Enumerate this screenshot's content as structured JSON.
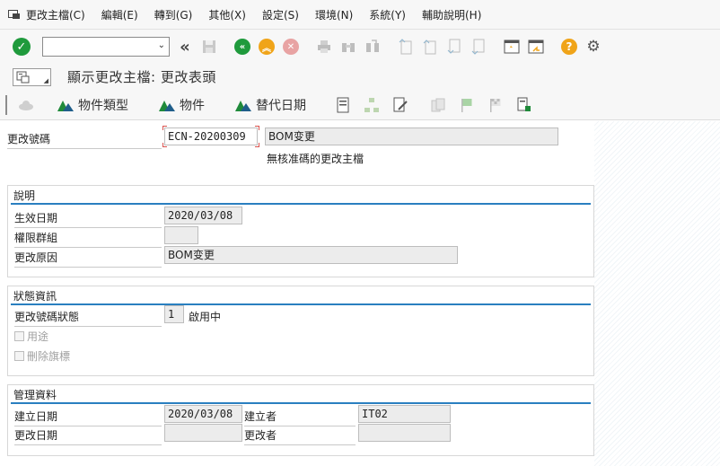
{
  "menu": {
    "items": [
      "更改主檔(C)",
      "編輯(E)",
      "轉到(G)",
      "其他(X)",
      "設定(S)",
      "環境(N)",
      "系統(Y)",
      "輔助說明(H)"
    ]
  },
  "toolbar": {
    "command_field_value": "",
    "icons": [
      "enter-icon",
      "back-double-icon",
      "save-icon",
      "back-icon",
      "exit-icon",
      "cancel-icon",
      "print-icon",
      "find-icon",
      "find-next-icon",
      "first-page-icon",
      "previous-page-icon",
      "next-page-icon",
      "last-page-icon",
      "new-session-icon",
      "shortcut-icon",
      "help-icon",
      "settings-icon"
    ]
  },
  "title": {
    "text": "顯示更改主檔: 更改表頭"
  },
  "app_toolbar": {
    "object_type_label": "物件類型",
    "object_label": "物件",
    "alt_date_label": "替代日期"
  },
  "header": {
    "change_number_label": "更改號碼",
    "change_number_value": "ECN-20200309",
    "description_value": "BOM变更",
    "note_text": "無核准碼的更改主檔"
  },
  "description_group": {
    "title": "說明",
    "valid_from_label": "生效日期",
    "valid_from_value": "2020/03/08",
    "auth_group_label": "權限群組",
    "auth_group_value": "",
    "reason_label": "更改原因",
    "reason_value": "BOM变更"
  },
  "status_group": {
    "title": "狀態資訊",
    "status_label": "更改號碼狀態",
    "status_value": "1",
    "status_text": "啟用中",
    "usage_label": "用途",
    "deletion_flag_label": "刪除旗標"
  },
  "admin_group": {
    "title": "管理資料",
    "created_on_label": "建立日期",
    "created_on_value": "2020/03/08",
    "created_by_label": "建立者",
    "created_by_value": "IT02",
    "changed_on_label": "更改日期",
    "changed_on_value": "",
    "changed_by_label": "更改者",
    "changed_by_value": ""
  },
  "colors": {
    "accent_blue": "#2a7fc0",
    "ok_green": "#1f9a3c",
    "warn_orange": "#f0a419",
    "required_red": "#d9534f"
  }
}
